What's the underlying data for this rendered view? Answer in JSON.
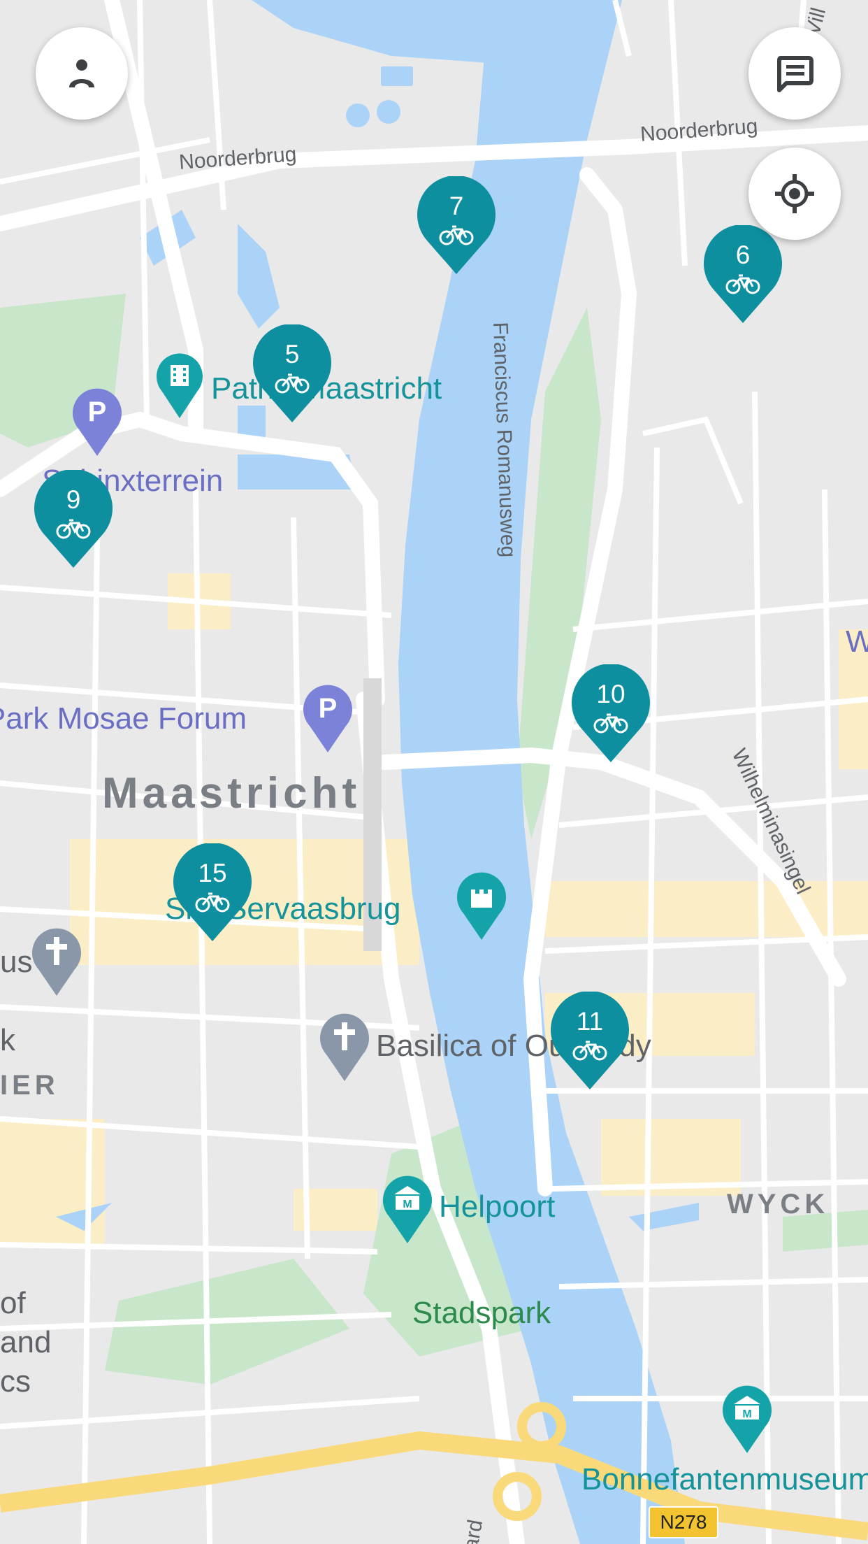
{
  "map": {
    "poi_labels": {
      "pathe": "Pathé Maastricht",
      "sphinx": "Sphinxterrein",
      "mosae": "Q-Park Mosae Forum",
      "servaasbrug": "Sint Servaasbrug",
      "basilica": "Basilica of Our Lady",
      "helpoort": "Helpoort",
      "stadspark": "Stadspark",
      "bonnefanten": "Bonnefantenmuseum",
      "edge_us": "us",
      "edge_k": "k",
      "edge_of": "of",
      "edge_and": "and",
      "edge_cs": "cs"
    },
    "street_labels": {
      "noorderbrug_left": "Noorderbrug",
      "noorderbrug_right": "Noorderbrug",
      "romanusweg": "Franciscus Romanusweg",
      "wilhelminasingel": "Wilhelminasingel",
      "edge_ard": "ard",
      "edge_vill": "Vill",
      "edge_w": "W"
    },
    "area_labels": {
      "city": "Maastricht",
      "wyck": "WYCK",
      "ier": "IER"
    },
    "road_shield": "N278",
    "bike_stations": [
      "7",
      "6",
      "5",
      "9",
      "10",
      "15",
      "11"
    ],
    "station_icon": "bicycle-icon",
    "colors": {
      "water": "#aad3f7",
      "park": "#c8e6c9",
      "land": "#e9e9ea",
      "road": "#ffffff",
      "pin": "#0e8fa0",
      "poi_teal": "#14949a",
      "poi_purple": "#7b82d8",
      "highway": "#f9d97a"
    }
  },
  "controls": {
    "profile_icon": "person-icon",
    "feedback_icon": "message-icon",
    "locate_icon": "my-location-icon"
  }
}
